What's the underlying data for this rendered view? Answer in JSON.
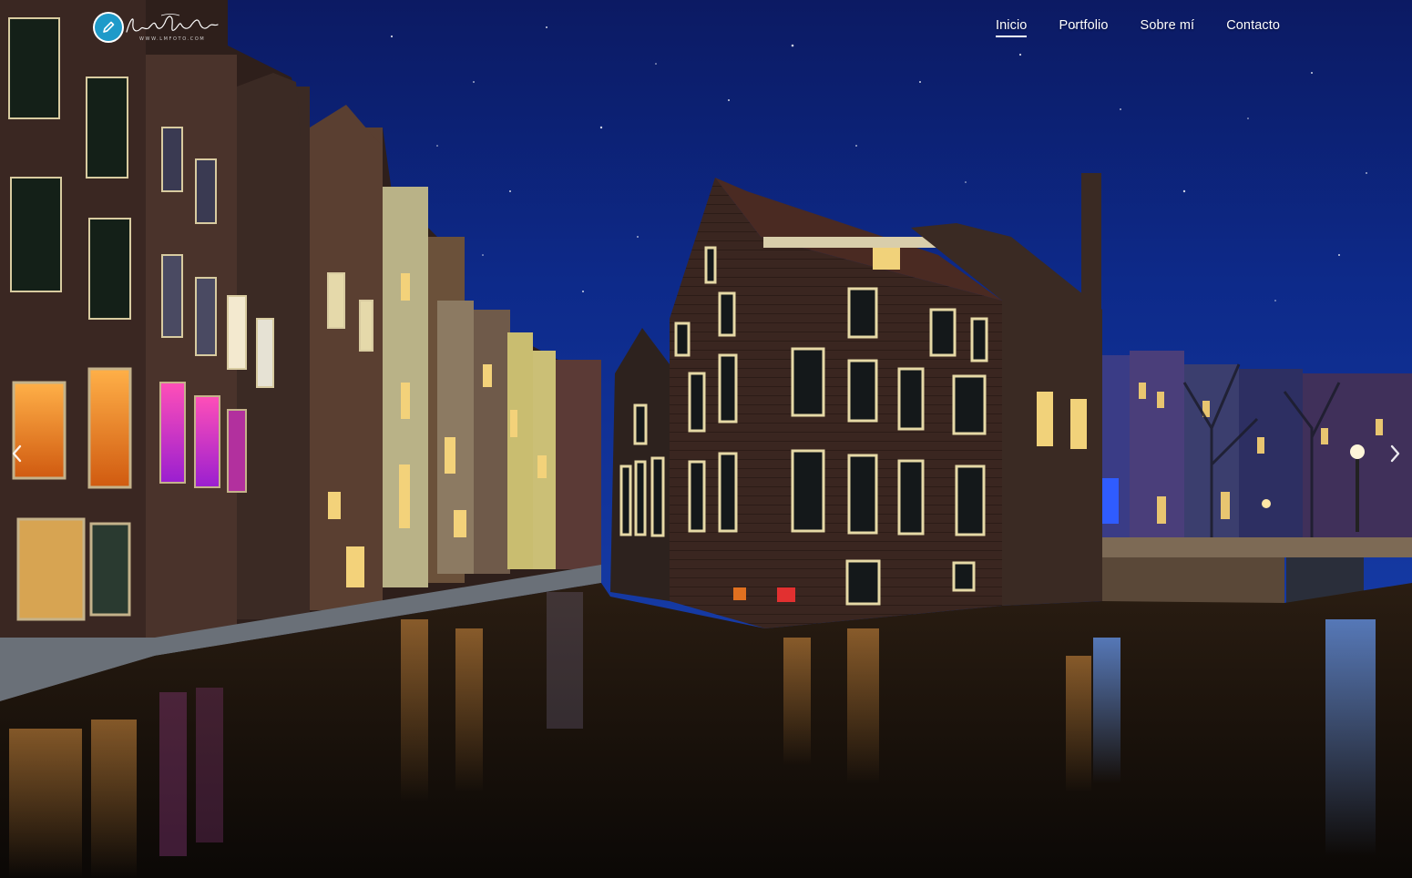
{
  "brand": {
    "logo_icon": "pencil-icon",
    "tagline": "WWW.LMFOTO.COM",
    "accent_color": "#1e9ac9"
  },
  "nav": {
    "items": [
      {
        "label": "Inicio",
        "active": true
      },
      {
        "label": "Portfolio",
        "active": false
      },
      {
        "label": "Sobre mí",
        "active": false
      },
      {
        "label": "Contacto",
        "active": false
      }
    ]
  },
  "slider": {
    "prev_icon": "chevron-left-icon",
    "next_icon": "chevron-right-icon"
  }
}
